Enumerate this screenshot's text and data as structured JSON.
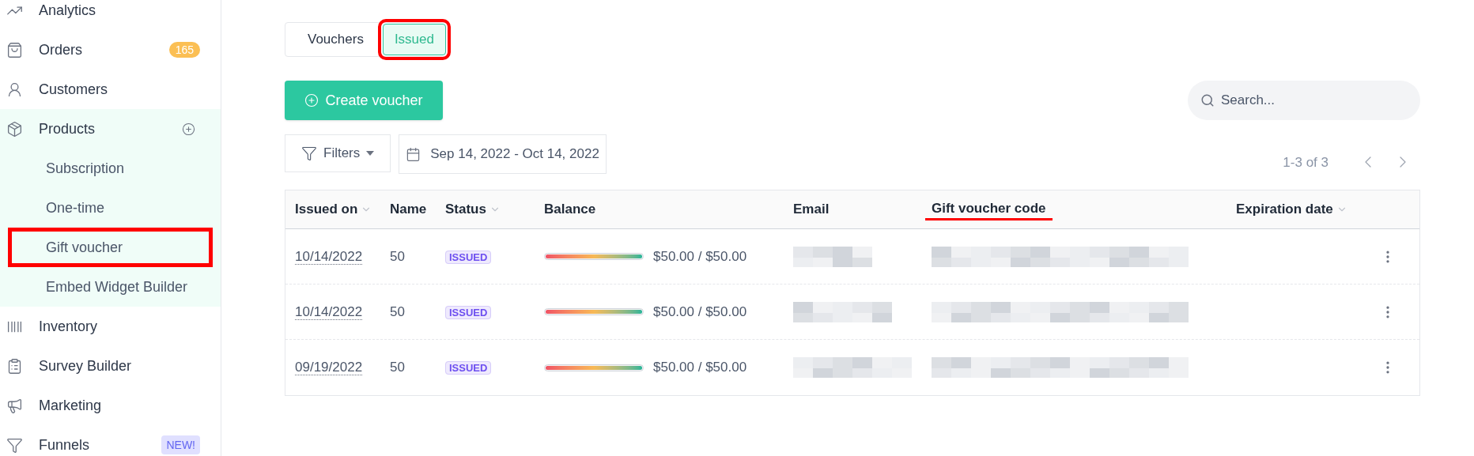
{
  "sidebar": {
    "items": [
      {
        "label": "Analytics",
        "expanded": false
      },
      {
        "label": "Orders",
        "badge": {
          "text": "165",
          "kind": "count"
        },
        "expanded": false
      },
      {
        "label": "Customers",
        "expanded": false
      },
      {
        "label": "Products",
        "expanded": true,
        "children": [
          {
            "label": "Subscription",
            "highlighted": false
          },
          {
            "label": "One-time",
            "highlighted": false
          },
          {
            "label": "Gift voucher",
            "highlighted": true
          },
          {
            "label": "Embed Widget Builder",
            "highlighted": false
          }
        ]
      },
      {
        "label": "Inventory",
        "expanded": false
      },
      {
        "label": "Survey Builder",
        "expanded": false
      },
      {
        "label": "Marketing",
        "expanded": false
      },
      {
        "label": "Funnels",
        "badge": {
          "text": "NEW!",
          "kind": "new"
        },
        "expanded": false
      }
    ]
  },
  "tabs": [
    {
      "label": "Vouchers",
      "selected": false,
      "highlighted": false
    },
    {
      "label": "Issued",
      "selected": true,
      "highlighted": true
    }
  ],
  "create_button": "Create voucher",
  "search": {
    "placeholder": "Search..."
  },
  "filters": {
    "label": "Filters",
    "date_range": "Sep 14, 2022 - Oct 14, 2022"
  },
  "pagination": {
    "text": "1-3 of 3"
  },
  "table": {
    "columns": [
      {
        "label": "Issued on",
        "sortable": true,
        "highlighted": false
      },
      {
        "label": "Name",
        "sortable": false,
        "highlighted": false
      },
      {
        "label": "Status",
        "sortable": true,
        "highlighted": false
      },
      {
        "label": "Balance",
        "sortable": false,
        "highlighted": false
      },
      {
        "label": "Email",
        "sortable": false,
        "highlighted": false
      },
      {
        "label": "Gift voucher code",
        "sortable": false,
        "highlighted": true
      },
      {
        "label": "Expiration date",
        "sortable": true,
        "highlighted": false
      }
    ],
    "rows": [
      {
        "issued_on": "10/14/2022",
        "name": "50",
        "status": "ISSUED",
        "level": 1,
        "balance": "$50.00 / $50.00",
        "email_redacted": true,
        "code_redacted": true
      },
      {
        "issued_on": "10/14/2022",
        "name": "50",
        "status": "ISSUED",
        "level": 1,
        "balance": "$50.00 / $50.00",
        "email_redacted": true,
        "code_redacted": true
      },
      {
        "issued_on": "09/19/2022",
        "name": "50",
        "status": "ISSUED",
        "level": 1,
        "balance": "$50.00 / $50.00",
        "email_redacted": true,
        "code_redacted": true
      }
    ]
  }
}
